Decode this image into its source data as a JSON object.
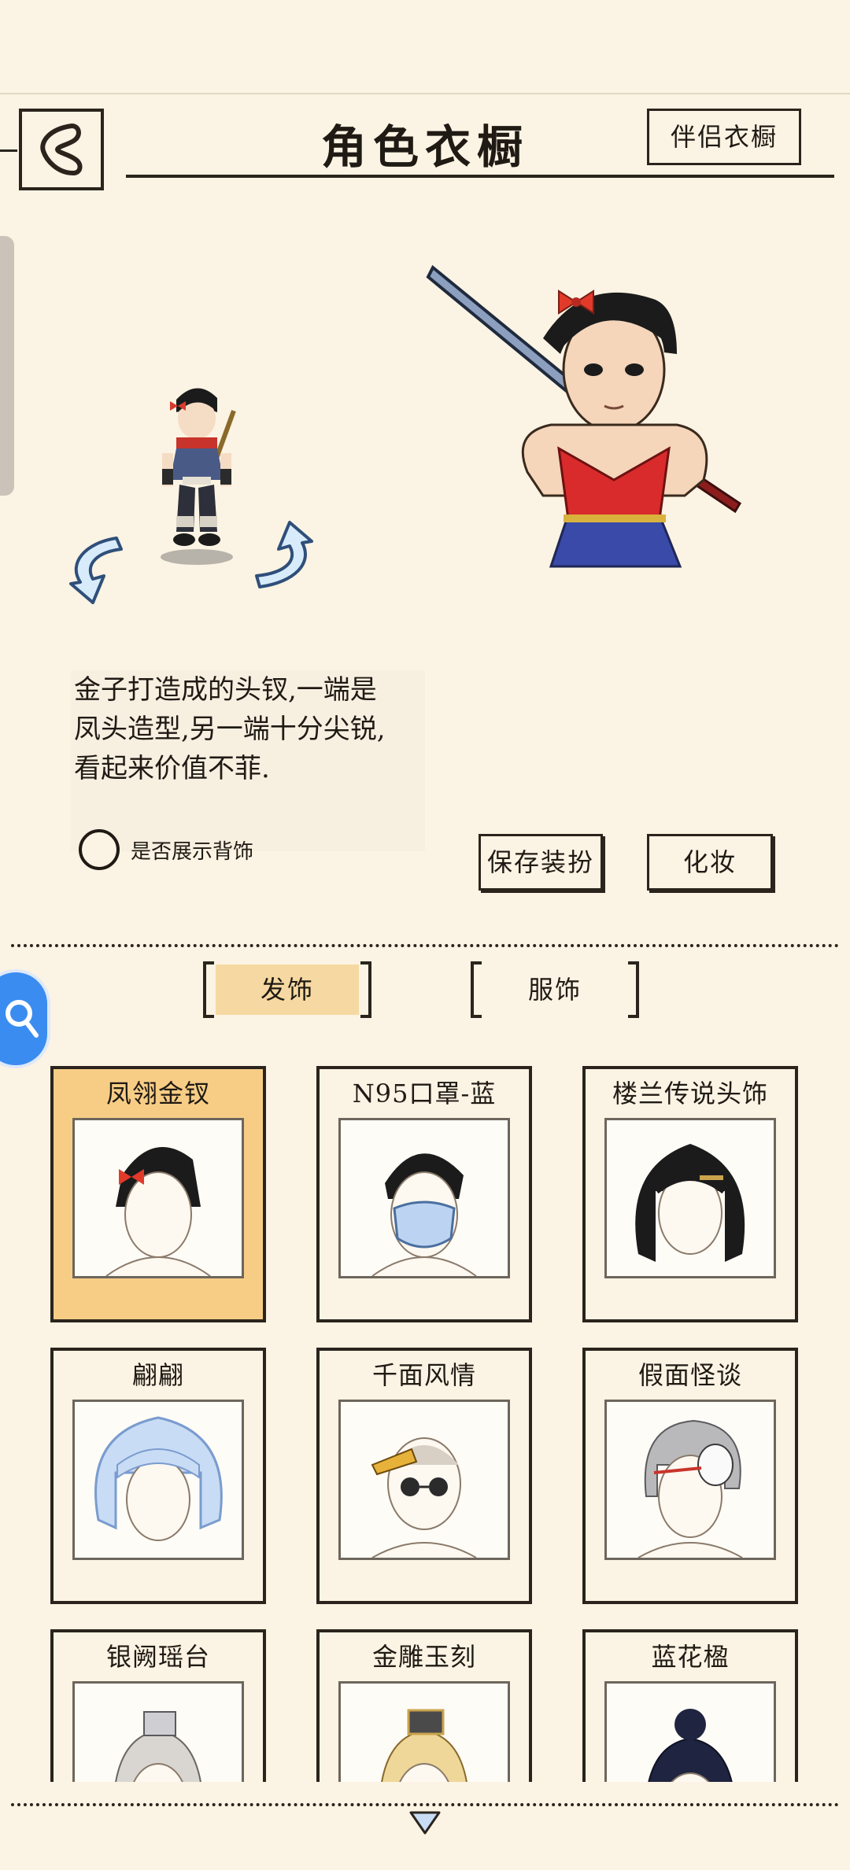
{
  "header": {
    "title": "角色衣橱",
    "partner_button": "伴侣衣橱"
  },
  "description": "金子打造成的头钗,一端是\n凤头造型,另一端十分尖锐,\n看起来价值不菲.",
  "options": {
    "show_back_accessory_label": "是否展示背饰",
    "show_back_accessory_checked": false
  },
  "actions": {
    "save_label": "保存装扮",
    "makeup_label": "化妆"
  },
  "tabs": [
    {
      "label": "发饰",
      "active": true
    },
    {
      "label": "服饰",
      "active": false
    }
  ],
  "items": [
    {
      "name": "凤翎金钗",
      "selected": true
    },
    {
      "name": "N95口罩-蓝",
      "selected": false
    },
    {
      "name": "楼兰传说头饰",
      "selected": false
    },
    {
      "name": "翩翩",
      "selected": false
    },
    {
      "name": "千面风情",
      "selected": false
    },
    {
      "name": "假面怪谈",
      "selected": false
    },
    {
      "name": "银阙瑶台",
      "selected": false
    },
    {
      "name": "金雕玉刻",
      "selected": false
    },
    {
      "name": "蓝花楹",
      "selected": false
    }
  ],
  "colors": {
    "background": "#fbf3e3",
    "selected_card": "#f7cd86",
    "active_tab": "#f6d9a2",
    "ink": "#2a241d",
    "fab_blue": "#3a8cf0"
  },
  "icons": {
    "back": "back-arrow-icon",
    "rotate_left": "rotate-left-icon",
    "rotate_right": "rotate-right-icon",
    "scroll_down": "triangle-down-icon",
    "search": "search-icon"
  }
}
